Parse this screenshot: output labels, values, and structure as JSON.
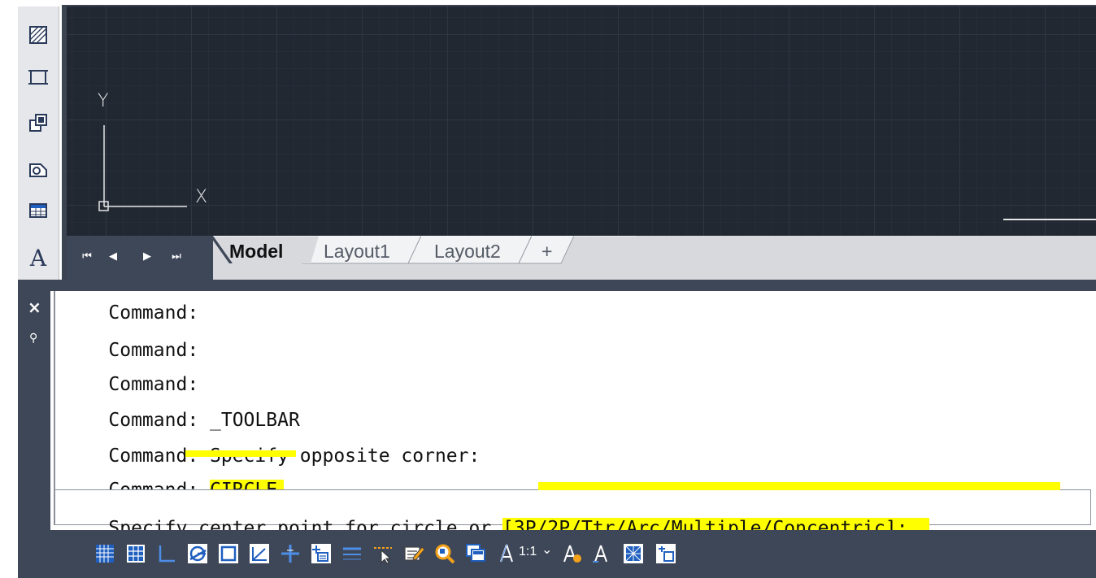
{
  "viewport": {
    "axis_y_label": "Y",
    "axis_x_label": "X"
  },
  "layout_tabs": {
    "tabs": [
      {
        "label": "Model",
        "active": true
      },
      {
        "label": "Layout1",
        "active": false
      },
      {
        "label": "Layout2",
        "active": false
      }
    ],
    "add_tab_label": "+"
  },
  "left_toolbar": {
    "items": [
      "hatch-icon",
      "viewport-rectangle-icon",
      "copy-objects-icon",
      "region-icon",
      "table-icon",
      "multiline-text-icon"
    ],
    "text_tool_glyph": "A"
  },
  "command_window": {
    "close_glyph": "×",
    "pin_glyph": "⚲",
    "history": [
      {
        "prefix": "Command:",
        "text": "",
        "highlight": ""
      },
      {
        "prefix": "Command:",
        "text": "",
        "highlight": ""
      },
      {
        "prefix": "Command:",
        "text": "",
        "highlight": ""
      },
      {
        "prefix": "Command:",
        "text": " _TOOLBAR",
        "highlight": ""
      },
      {
        "prefix": "Command:",
        "text": " Specify opposite corner:",
        "highlight": ""
      },
      {
        "prefix": "Command:",
        "text": " ",
        "highlight": "CIRCLE"
      }
    ],
    "prompt_prefix": "Specify center point for circle or ",
    "prompt_options": "[3P/2P/Ttr/Arc/Multiple/Concentric]:"
  },
  "status_bar": {
    "annotation_scale": "1:1",
    "scale_dropdown_glyph": "⌄",
    "icons": [
      "grid-icon",
      "snap-icon",
      "ortho-icon",
      "polar-tracking-icon",
      "object-snap-icon",
      "dynamic-ucs-icon",
      "dynamic-input-icon",
      "lineweight-icon",
      "transparency-icon",
      "selection-cycling-icon",
      "quick-properties-icon",
      "zoom-icon",
      "viewport-icon",
      "annotation-scale-icon",
      "annotation-visibility-icon",
      "auto-scale-icon",
      "hardware-acceleration-icon",
      "isolate-objects-icon"
    ]
  },
  "colors": {
    "viewport_bg": "#212832",
    "chrome_dark": "#3e4758",
    "highlight": "#ffff00",
    "icon_blue": "#1f5fbf"
  }
}
